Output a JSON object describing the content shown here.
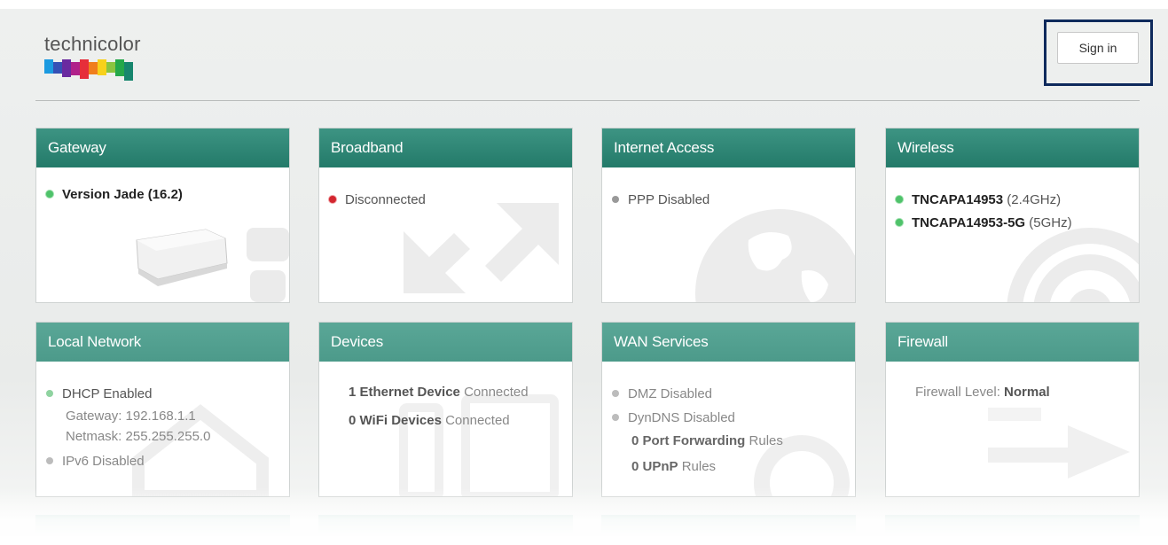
{
  "brand": {
    "name": "technicolor",
    "bar_colors": [
      "#1b9ae0",
      "#3550b5",
      "#6a2aa0",
      "#b0208a",
      "#e62e3a",
      "#f07e1c",
      "#f8d11b",
      "#8bc43f",
      "#25a84a",
      "#17866e"
    ]
  },
  "header": {
    "sign_in_label": "Sign in"
  },
  "cards": {
    "gateway": {
      "title": "Gateway",
      "version": "Version Jade (16.2)"
    },
    "broadband": {
      "title": "Broadband",
      "status": "Disconnected"
    },
    "internet": {
      "title": "Internet Access",
      "status": "PPP Disabled"
    },
    "wireless": {
      "title": "Wireless",
      "ssid_24": "TNCAPA14953",
      "band_24": "(2.4GHz)",
      "ssid_5": "TNCAPA14953-5G",
      "band_5": "(5GHz)"
    },
    "local_network": {
      "title": "Local Network",
      "dhcp": "DHCP Enabled",
      "gateway": "Gateway: 192.168.1.1",
      "netmask": "Netmask: 255.255.255.0",
      "ipv6": "IPv6 Disabled"
    },
    "devices": {
      "title": "Devices",
      "ethernet_count": "1 Ethernet Device",
      "ethernet_suffix": "Connected",
      "wifi_count": "0 WiFi Devices",
      "wifi_suffix": "Connected"
    },
    "wan_services": {
      "title": "WAN Services",
      "dmz": "DMZ Disabled",
      "dyndns": "DynDNS Disabled",
      "port_fwd_count": "0 Port Forwarding",
      "port_fwd_suffix": "Rules",
      "upnp_count": "0 UPnP",
      "upnp_suffix": "Rules"
    },
    "firewall": {
      "title": "Firewall",
      "level_label": "Firewall Level:",
      "level_value": "Normal"
    }
  },
  "colors": {
    "header_teal": "#237a69",
    "status_green": "#4fc26a",
    "status_red": "#d3262f",
    "status_grey": "#999999",
    "signin_highlight": "#0e2a5c"
  }
}
